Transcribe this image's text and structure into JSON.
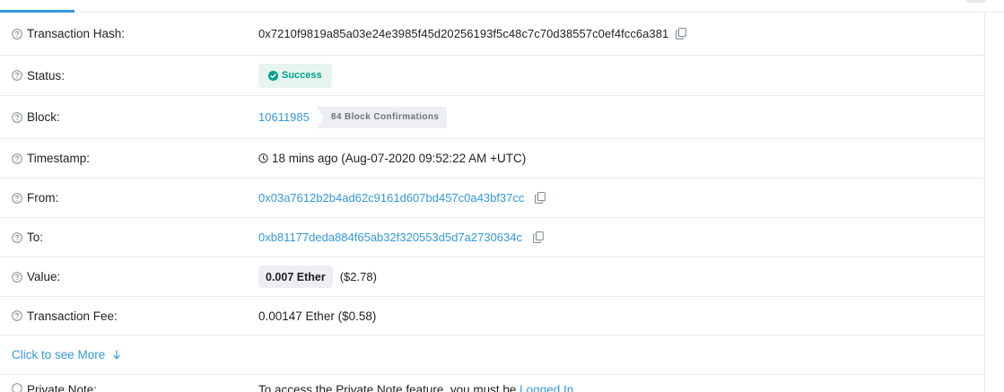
{
  "rows": {
    "hash": {
      "label": "Transaction Hash:",
      "value": "0x7210f9819a85a03e24e3985f45d20256193f5c48c7c70d38557c0ef4fcc6a381"
    },
    "status": {
      "label": "Status:",
      "value": "Success"
    },
    "block": {
      "label": "Block:",
      "value": "10611985",
      "confirmations": "84 Block Confirmations"
    },
    "timestamp": {
      "label": "Timestamp:",
      "value": "18 mins ago (Aug-07-2020 09:52:22 AM +UTC)"
    },
    "from": {
      "label": "From:",
      "value": "0x03a7612b2b4ad62c9161d607bd457c0a43bf37cc"
    },
    "to": {
      "label": "To:",
      "value": "0xb81177deda884f65ab32f320553d5d7a2730634c"
    },
    "value": {
      "label": "Value:",
      "amount": "0.007 Ether",
      "usd": "($2.78)"
    },
    "fee": {
      "label": "Transaction Fee:",
      "value": "0.00147 Ether ($0.58)"
    }
  },
  "more_link": "Click to see More",
  "cut_row": {
    "label": "Private Note:",
    "value_prefix": "To access the Private Note feature, you must be",
    "value_link": "Logged In"
  },
  "colors": {
    "accent": "#3498db",
    "success": "#00a186",
    "success_bg": "#e6f4ef",
    "badge_bg": "#eceef1",
    "border": "#e7eaf3"
  },
  "icons": {
    "help": "question-circle-icon",
    "copy": "copy-icon",
    "check": "check-circle-icon",
    "clock": "clock-icon",
    "arrow": "arrow-down-icon"
  }
}
